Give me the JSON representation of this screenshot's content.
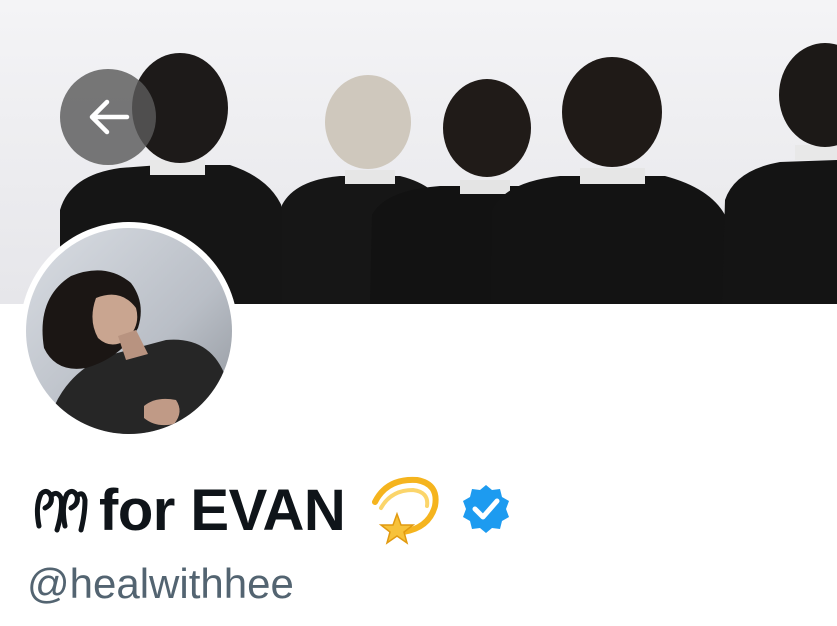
{
  "profile": {
    "display_name": "for EVAN",
    "handle": "@healwithhee",
    "verified": true
  },
  "icons": {
    "back": "arrow-left-icon",
    "name_glyph": "ribbon-glyph-icon",
    "name_emoji": "dizzy-star-icon",
    "verified": "verified-badge-icon"
  },
  "colors": {
    "verified_blue": "#1d9bf0",
    "handle_gray": "#536471",
    "name_black": "#0f1419",
    "back_button": "#5a5a5a"
  }
}
